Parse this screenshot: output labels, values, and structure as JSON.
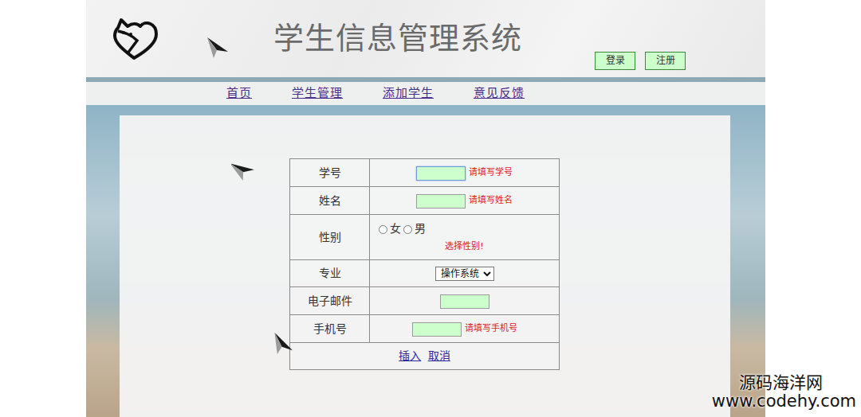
{
  "header": {
    "title": "学生信息管理系统",
    "buttons": [
      {
        "label": "登录"
      },
      {
        "label": "注册"
      }
    ]
  },
  "nav": [
    {
      "label": "首页"
    },
    {
      "label": "学生管理"
    },
    {
      "label": "添加学生"
    },
    {
      "label": "意见反馈"
    }
  ],
  "form": {
    "rows": [
      {
        "kind": "text",
        "label": "学号",
        "hint": "请填写学号",
        "focused": true
      },
      {
        "kind": "text",
        "label": "姓名",
        "hint": "请填写姓名",
        "focused": false
      },
      {
        "kind": "radio",
        "label": "性别",
        "options": [
          {
            "label": "女",
            "selected": false
          },
          {
            "label": "男",
            "selected": false
          }
        ],
        "hint": "选择性别!"
      },
      {
        "kind": "select",
        "label": "专业",
        "value": "操作系统"
      },
      {
        "kind": "text",
        "label": "电子邮件",
        "focused": false
      },
      {
        "kind": "text",
        "label": "手机号",
        "hint": "请填写手机号",
        "focused": false
      }
    ],
    "actions": [
      {
        "label": "插入"
      },
      {
        "label": "取消"
      }
    ]
  },
  "watermark": {
    "name": "源码海洋网",
    "url": "www.codehy.com"
  }
}
